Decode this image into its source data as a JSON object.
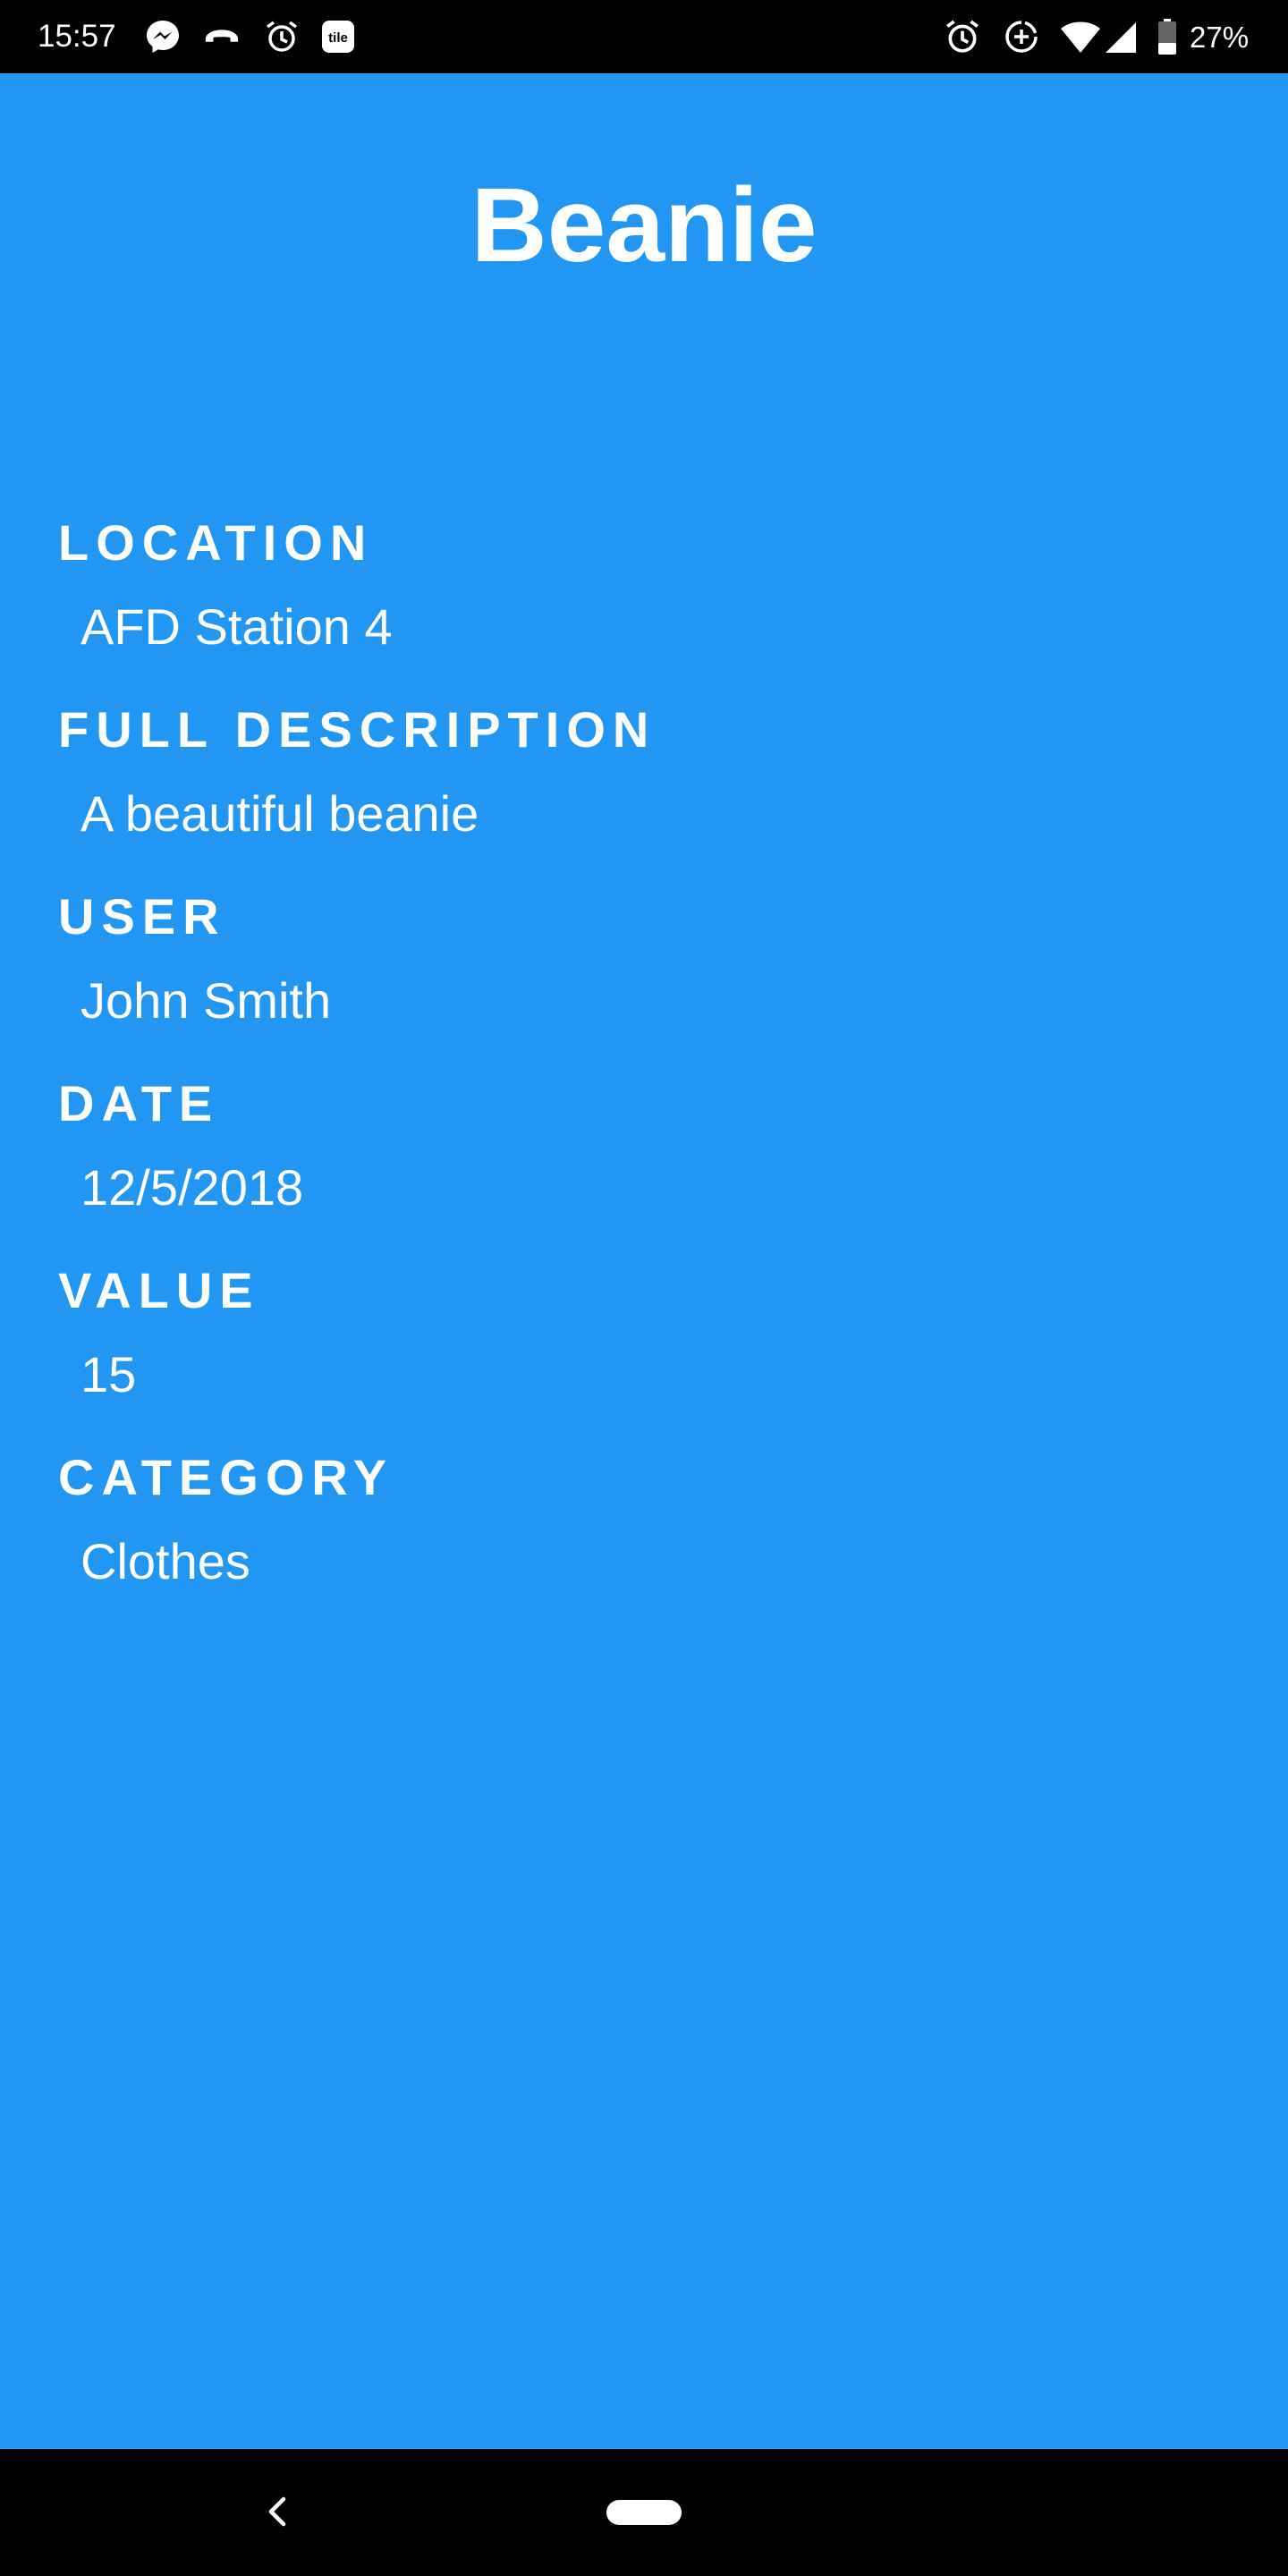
{
  "status_bar": {
    "time": "15:57",
    "battery_percent": "27%",
    "notification_icons": [
      "messenger-icon",
      "phone-call-icon",
      "alarm-icon",
      "tile-icon"
    ],
    "system_icons": [
      "alarm-icon",
      "data-saver-icon",
      "wifi-icon",
      "cellular-signal-icon",
      "battery-icon"
    ],
    "tile_label": "tile"
  },
  "item": {
    "title": "Beanie",
    "fields": [
      {
        "label": "LOCATION",
        "value": "AFD Station 4"
      },
      {
        "label": "FULL DESCRIPTION",
        "value": "A beautiful beanie"
      },
      {
        "label": "USER",
        "value": "John Smith"
      },
      {
        "label": "DATE",
        "value": "12/5/2018"
      },
      {
        "label": "VALUE",
        "value": "15"
      },
      {
        "label": "CATEGORY",
        "value": "Clothes"
      }
    ]
  },
  "colors": {
    "background": "#2196f3",
    "text": "#ffffff",
    "system_bars": "#000000"
  },
  "nav_bar": {
    "icons": [
      "back-icon",
      "home-pill-icon"
    ]
  }
}
